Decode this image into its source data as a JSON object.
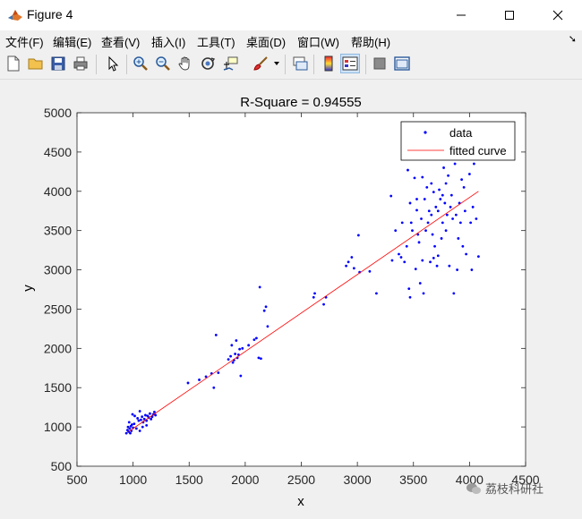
{
  "window": {
    "title": "Figure 4",
    "minimize_icon": "minimize-icon",
    "maximize_icon": "maximize-icon",
    "close_icon": "close-icon"
  },
  "menu": {
    "items": [
      "文件(F)",
      "编辑(E)",
      "查看(V)",
      "插入(I)",
      "工具(T)",
      "桌面(D)",
      "窗口(W)",
      "帮助(H)"
    ],
    "overflow": "➘"
  },
  "toolbar": {
    "icons": [
      "new-figure-icon",
      "open-file-icon",
      "save-icon",
      "print-icon",
      "pointer-icon",
      "zoom-in-icon",
      "zoom-out-icon",
      "pan-hand-icon",
      "rotate-3d-icon",
      "data-cursor-icon",
      "brush-icon",
      "brush-dropdown-icon",
      "link-plot-icon",
      "colorbar-icon",
      "legend-icon",
      "hide-plot-tools-icon",
      "show-plot-tools-icon"
    ]
  },
  "watermark": {
    "text": "荔枝科研社"
  },
  "chart_data": {
    "type": "scatter",
    "title": "R-Square = 0.94555",
    "xlabel": "x",
    "ylabel": "y",
    "xlim": [
      500,
      4500
    ],
    "ylim": [
      500,
      5000
    ],
    "xticks": [
      500,
      1000,
      1500,
      2000,
      2500,
      3000,
      3500,
      4000,
      4500
    ],
    "yticks": [
      500,
      1000,
      1500,
      2000,
      2500,
      3000,
      3500,
      4000,
      4500,
      5000
    ],
    "grid": false,
    "legend": {
      "placement": "top-right",
      "entries": [
        "data",
        "fitted curve"
      ]
    },
    "colors": {
      "data": "#0000ff",
      "fitted_curve": "#ff0000"
    },
    "fitted_curve": {
      "x": [
        960,
        4080
      ],
      "y": [
        940,
        4000
      ]
    },
    "series": [
      {
        "name": "data",
        "points": [
          [
            940,
            920
          ],
          [
            950,
            960
          ],
          [
            955,
            1000
          ],
          [
            960,
            940
          ],
          [
            965,
            1060
          ],
          [
            970,
            980
          ],
          [
            975,
            920
          ],
          [
            980,
            1010
          ],
          [
            985,
            950
          ],
          [
            990,
            1030
          ],
          [
            995,
            1160
          ],
          [
            1000,
            990
          ],
          [
            1010,
            1040
          ],
          [
            1030,
            980
          ],
          [
            1040,
            1110
          ],
          [
            1050,
            1080
          ],
          [
            1060,
            1200
          ],
          [
            1070,
            1090
          ],
          [
            1080,
            1130
          ],
          [
            1090,
            1060
          ],
          [
            1100,
            1100
          ],
          [
            1110,
            1150
          ],
          [
            1120,
            1080
          ],
          [
            1130,
            1140
          ],
          [
            1140,
            1120
          ],
          [
            1150,
            1170
          ],
          [
            1160,
            1100
          ],
          [
            1170,
            1130
          ],
          [
            1180,
            1160
          ],
          [
            1190,
            1190
          ],
          [
            1200,
            1150
          ],
          [
            1060,
            950
          ],
          [
            1085,
            1000
          ],
          [
            1120,
            1020
          ],
          [
            1015,
            1140
          ],
          [
            1490,
            1560
          ],
          [
            1590,
            1600
          ],
          [
            1650,
            1640
          ],
          [
            1700,
            1680
          ],
          [
            1720,
            1500
          ],
          [
            1740,
            2170
          ],
          [
            1760,
            1690
          ],
          [
            1850,
            1860
          ],
          [
            1870,
            1900
          ],
          [
            1880,
            2040
          ],
          [
            1890,
            1820
          ],
          [
            1900,
            1850
          ],
          [
            1910,
            1930
          ],
          [
            1920,
            2100
          ],
          [
            1930,
            1880
          ],
          [
            1940,
            1920
          ],
          [
            1950,
            1990
          ],
          [
            1960,
            1650
          ],
          [
            1975,
            2000
          ],
          [
            2030,
            2040
          ],
          [
            2080,
            2110
          ],
          [
            2100,
            2130
          ],
          [
            2120,
            1880
          ],
          [
            2130,
            2780
          ],
          [
            2140,
            1870
          ],
          [
            2170,
            2480
          ],
          [
            2185,
            2530
          ],
          [
            2200,
            2280
          ],
          [
            2610,
            2650
          ],
          [
            2620,
            2700
          ],
          [
            2700,
            2560
          ],
          [
            2720,
            2650
          ],
          [
            2900,
            3050
          ],
          [
            2920,
            3100
          ],
          [
            2950,
            3160
          ],
          [
            2970,
            3020
          ],
          [
            3010,
            3440
          ],
          [
            3020,
            2970
          ],
          [
            3110,
            2980
          ],
          [
            3170,
            2700
          ],
          [
            3300,
            3940
          ],
          [
            3310,
            3120
          ],
          [
            3340,
            3500
          ],
          [
            3370,
            3200
          ],
          [
            3390,
            3160
          ],
          [
            3400,
            3600
          ],
          [
            3420,
            3100
          ],
          [
            3440,
            3300
          ],
          [
            3450,
            4270
          ],
          [
            3460,
            2760
          ],
          [
            3470,
            2650
          ],
          [
            3480,
            3600
          ],
          [
            3490,
            3500
          ],
          [
            3510,
            4170
          ],
          [
            3520,
            3010
          ],
          [
            3530,
            3760
          ],
          [
            3540,
            3450
          ],
          [
            3550,
            3350
          ],
          [
            3560,
            2830
          ],
          [
            3570,
            3650
          ],
          [
            3580,
            3120
          ],
          [
            3590,
            2700
          ],
          [
            3600,
            3900
          ],
          [
            3610,
            3500
          ],
          [
            3620,
            4050
          ],
          [
            3630,
            3600
          ],
          [
            3640,
            4420
          ],
          [
            3650,
            3100
          ],
          [
            3660,
            3700
          ],
          [
            3670,
            3450
          ],
          [
            3680,
            3990
          ],
          [
            3690,
            3300
          ],
          [
            3700,
            3800
          ],
          [
            3710,
            3050
          ],
          [
            3720,
            3750
          ],
          [
            3730,
            4020
          ],
          [
            3740,
            3900
          ],
          [
            3750,
            3400
          ],
          [
            3760,
            3600
          ],
          [
            3770,
            4300
          ],
          [
            3780,
            3850
          ],
          [
            3790,
            4100
          ],
          [
            3800,
            3700
          ],
          [
            3810,
            4200
          ],
          [
            3820,
            3050
          ],
          [
            3830,
            3800
          ],
          [
            3840,
            3950
          ],
          [
            3850,
            3650
          ],
          [
            3860,
            2700
          ],
          [
            3870,
            4350
          ],
          [
            3880,
            3700
          ],
          [
            3890,
            3000
          ],
          [
            3900,
            3400
          ],
          [
            3910,
            3850
          ],
          [
            3920,
            3600
          ],
          [
            3930,
            4150
          ],
          [
            3940,
            3300
          ],
          [
            3950,
            4050
          ],
          [
            3960,
            3750
          ],
          [
            3970,
            3200
          ],
          [
            4000,
            4220
          ],
          [
            4010,
            3600
          ],
          [
            4020,
            3000
          ],
          [
            4030,
            3800
          ],
          [
            4040,
            4350
          ],
          [
            4060,
            3650
          ],
          [
            4080,
            3170
          ],
          [
            3660,
            4100
          ],
          [
            3680,
            3150
          ],
          [
            3720,
            3180
          ],
          [
            3760,
            3950
          ],
          [
            3790,
            3500
          ],
          [
            3530,
            3900
          ],
          [
            3580,
            4180
          ],
          [
            3470,
            3850
          ],
          [
            3640,
            3750
          ]
        ]
      }
    ]
  }
}
